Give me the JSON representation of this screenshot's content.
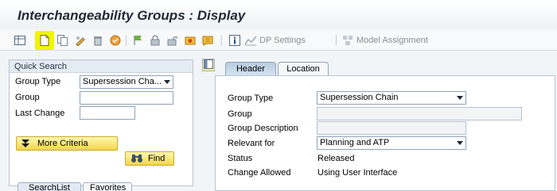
{
  "title": "Interchangeability Groups : Display",
  "toolbar": {
    "items": [
      {
        "icon": "table-icon"
      },
      {
        "icon": "new-document-icon"
      },
      {
        "icon": "copy-icon"
      },
      {
        "icon": "edit-icon"
      },
      {
        "icon": "delete-icon"
      },
      {
        "icon": "check-icon"
      },
      {
        "icon": "flag-icon"
      },
      {
        "icon": "lock-icon"
      },
      {
        "icon": "unlock-icon"
      },
      {
        "icon": "release-icon"
      },
      {
        "icon": "notes-icon"
      },
      {
        "icon": "info-icon"
      }
    ],
    "dp_settings": "DP Settings",
    "model_assignment": "Model Assignment"
  },
  "quick_search": {
    "header": "Quick Search",
    "group_type_label": "Group Type",
    "group_type_value": "Supersession Cha...",
    "group_label": "Group",
    "group_value": "",
    "last_change_label": "Last Change",
    "last_change_value": "",
    "more_criteria": "More Criteria",
    "find": "Find"
  },
  "bottom_tabs": {
    "search_list": "SearchList",
    "favorites": "Favorites"
  },
  "detail": {
    "tabs": [
      "Header",
      "Location"
    ],
    "rows": {
      "group_type_label": "Group Type",
      "group_type_value": "Supersession Chain",
      "group_label": "Group",
      "group_value": "",
      "group_description_label": "Group Description",
      "group_description_value": "",
      "relevant_for_label": "Relevant for",
      "relevant_for_value": "Planning and ATP",
      "status_label": "Status",
      "status_value": "Released",
      "change_allowed_label": "Change Allowed",
      "change_allowed_value": "Using User Interface"
    }
  },
  "colors": {
    "highlight": "#f1f500",
    "button": "#f3d64b",
    "tab_active": "#b7cde2"
  }
}
